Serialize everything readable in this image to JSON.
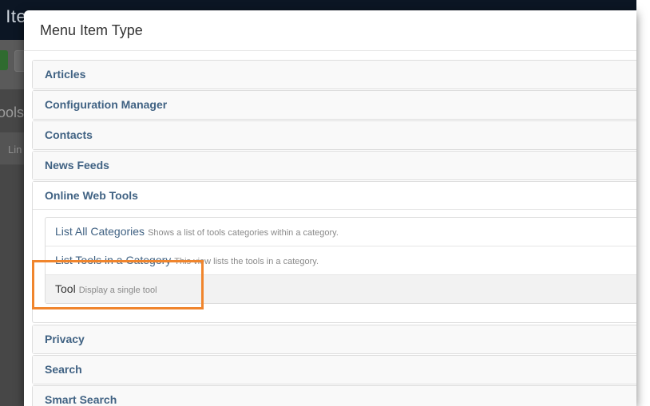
{
  "background": {
    "title_fragment": "t Ite",
    "tools_fragment": "ools",
    "link_fragment": "Lin"
  },
  "modal": {
    "title": "Menu Item Type",
    "groups": [
      {
        "label": "Articles"
      },
      {
        "label": "Configuration Manager"
      },
      {
        "label": "Contacts"
      },
      {
        "label": "News Feeds"
      },
      {
        "label": "Online Web Tools",
        "expanded": true,
        "items": [
          {
            "label": "List All Categories",
            "description": "Shows a list of tools categories within a category."
          },
          {
            "label": "List Tools in a Category",
            "description": "This view lists the tools in a category."
          },
          {
            "label": "Tool",
            "description": "Display a single tool"
          }
        ]
      },
      {
        "label": "Privacy"
      },
      {
        "label": "Search"
      },
      {
        "label": "Smart Search"
      }
    ]
  },
  "colors": {
    "link": "#406283",
    "highlight": "#f0852d"
  }
}
